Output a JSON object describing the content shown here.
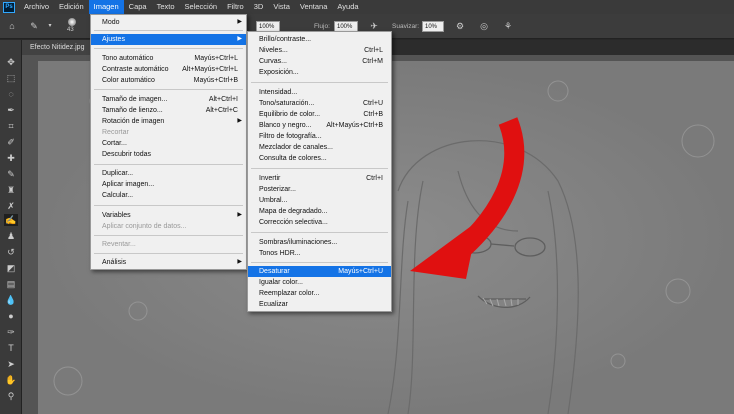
{
  "menubar": {
    "items": [
      "Archivo",
      "Edición",
      "Imagen",
      "Capa",
      "Texto",
      "Selección",
      "Filtro",
      "3D",
      "Vista",
      "Ventana",
      "Ayuda"
    ],
    "active_index": 2,
    "logo": "Ps"
  },
  "options": {
    "brush_size": "43",
    "mode_value": "100%",
    "opacity_value": "100%",
    "flujo_label": "Flujo:",
    "flujo_value": "100%",
    "suavizar_label": "Suavizar:",
    "suavizar_value": "10%"
  },
  "document": {
    "tab_label": "Efecto Nitidez.jpg"
  },
  "imagen_menu": {
    "items": [
      {
        "label": "Modo",
        "shortcut": "",
        "submenu": true,
        "disabled": false
      },
      {
        "label": "Ajustes",
        "shortcut": "",
        "submenu": true,
        "disabled": false,
        "highlighted": true
      },
      {
        "label": "Tono automático",
        "shortcut": "Mayús+Ctrl+L"
      },
      {
        "label": "Contraste automático",
        "shortcut": "Alt+Mayús+Ctrl+L"
      },
      {
        "label": "Color automático",
        "shortcut": "Mayús+Ctrl+B"
      },
      {
        "label": "Tamaño de imagen...",
        "shortcut": "Alt+Ctrl+I"
      },
      {
        "label": "Tamaño de lienzo...",
        "shortcut": "Alt+Ctrl+C"
      },
      {
        "label": "Rotación de imagen",
        "shortcut": "",
        "submenu": true
      },
      {
        "label": "Recortar",
        "shortcut": "",
        "disabled": true
      },
      {
        "label": "Cortar...",
        "shortcut": ""
      },
      {
        "label": "Descubrir todas",
        "shortcut": ""
      },
      {
        "label": "Duplicar...",
        "shortcut": ""
      },
      {
        "label": "Aplicar imagen...",
        "shortcut": ""
      },
      {
        "label": "Calcular...",
        "shortcut": ""
      },
      {
        "label": "Variables",
        "shortcut": "",
        "submenu": true
      },
      {
        "label": "Aplicar conjunto de datos...",
        "shortcut": "",
        "disabled": true
      },
      {
        "label": "Reventar...",
        "shortcut": "",
        "disabled": true
      },
      {
        "label": "Análisis",
        "shortcut": "",
        "submenu": true
      }
    ]
  },
  "ajustes_menu": {
    "items": [
      {
        "label": "Brillo/contraste...",
        "shortcut": ""
      },
      {
        "label": "Niveles...",
        "shortcut": "Ctrl+L"
      },
      {
        "label": "Curvas...",
        "shortcut": "Ctrl+M"
      },
      {
        "label": "Exposición...",
        "shortcut": ""
      },
      {
        "label": "Intensidad...",
        "shortcut": ""
      },
      {
        "label": "Tono/saturación...",
        "shortcut": "Ctrl+U"
      },
      {
        "label": "Equilibrio de color...",
        "shortcut": "Ctrl+B"
      },
      {
        "label": "Blanco y negro...",
        "shortcut": "Alt+Mayús+Ctrl+B"
      },
      {
        "label": "Filtro de fotografía...",
        "shortcut": ""
      },
      {
        "label": "Mezclador de canales...",
        "shortcut": ""
      },
      {
        "label": "Consulta de colores...",
        "shortcut": ""
      },
      {
        "label": "Invertir",
        "shortcut": "Ctrl+I"
      },
      {
        "label": "Posterizar...",
        "shortcut": ""
      },
      {
        "label": "Umbral...",
        "shortcut": ""
      },
      {
        "label": "Mapa de degradado...",
        "shortcut": ""
      },
      {
        "label": "Corrección selectiva...",
        "shortcut": ""
      },
      {
        "label": "Sombras/iluminaciones...",
        "shortcut": ""
      },
      {
        "label": "Tonos HDR...",
        "shortcut": ""
      },
      {
        "label": "Desaturar",
        "shortcut": "Mayús+Ctrl+U",
        "highlighted": true
      },
      {
        "label": "Igualar color...",
        "shortcut": ""
      },
      {
        "label": "Reemplazar color...",
        "shortcut": ""
      },
      {
        "label": "Ecualizar",
        "shortcut": ""
      }
    ]
  },
  "colors": {
    "accent": "#1473e6",
    "arrow": "#e01010"
  }
}
